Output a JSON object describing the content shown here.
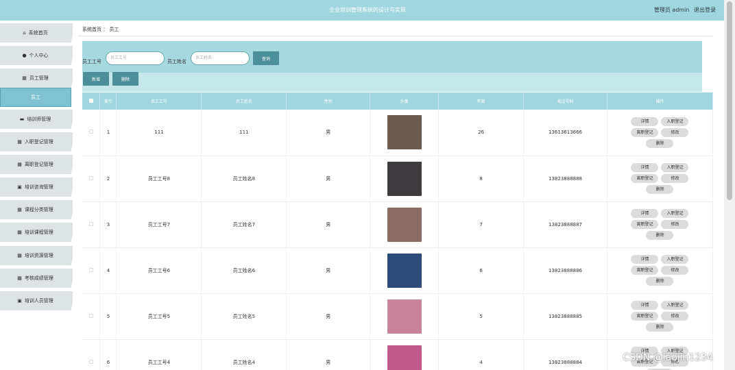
{
  "header": {
    "title": "企业培训管理系统的设计与实现",
    "user_label": "管理员 admin",
    "logout": "退出登录"
  },
  "sidebar": {
    "items": [
      {
        "icon": "home-icon",
        "glyph": "⌂",
        "label": "系统首页"
      },
      {
        "icon": "person-icon",
        "glyph": "●",
        "label": "个人中心"
      },
      {
        "icon": "grid-icon",
        "glyph": "▦",
        "label": "员工管理"
      },
      {
        "icon": "",
        "glyph": "",
        "label": "员工"
      },
      {
        "icon": "briefcase-icon",
        "glyph": "▬",
        "label": "培训师管理"
      },
      {
        "icon": "grid-icon",
        "glyph": "▦",
        "label": "入职登记管理"
      },
      {
        "icon": "grid-icon",
        "glyph": "▦",
        "label": "离职登记管理"
      },
      {
        "icon": "clipboard-icon",
        "glyph": "▣",
        "label": "培训咨询管理"
      },
      {
        "icon": "grid-icon",
        "glyph": "▦",
        "label": "课程分类管理"
      },
      {
        "icon": "grid-icon",
        "glyph": "▦",
        "label": "培训课程管理"
      },
      {
        "icon": "grid-icon",
        "glyph": "▦",
        "label": "培训资源管理"
      },
      {
        "icon": "grid-icon",
        "glyph": "▦",
        "label": "考核成绩管理"
      },
      {
        "icon": "clipboard-icon",
        "glyph": "▣",
        "label": "培训人员管理"
      }
    ]
  },
  "breadcrumb": {
    "home": "系统首页",
    "sep": "：",
    "current": "员工"
  },
  "search": {
    "id_label": "员工工号",
    "id_placeholder": "员工工号",
    "name_label": "员工姓名",
    "name_placeholder": "员工姓名",
    "query_button": "查询"
  },
  "actions": {
    "add": "新增",
    "delete": "删除"
  },
  "table": {
    "headers": [
      "索引",
      "员工工号",
      "员工姓名",
      "性别",
      "头像",
      "年龄",
      "电话号码",
      "操作"
    ],
    "ops": [
      "详情",
      "入职登记",
      "离职登记",
      "修改",
      "删除"
    ],
    "rows": [
      {
        "index": "1",
        "id": "111",
        "name": "111",
        "gender": "男",
        "age": "26",
        "phone": "13613613666",
        "photo_color": "#6b5a4e"
      },
      {
        "index": "2",
        "id": "员工工号8",
        "name": "员工姓名8",
        "gender": "男",
        "age": "8",
        "phone": "13823888888",
        "photo_color": "#3e3a3d"
      },
      {
        "index": "3",
        "id": "员工工号7",
        "name": "员工姓名7",
        "gender": "男",
        "age": "7",
        "phone": "13823888887",
        "photo_color": "#8a6c63"
      },
      {
        "index": "4",
        "id": "员工工号6",
        "name": "员工姓名6",
        "gender": "男",
        "age": "6",
        "phone": "13823888886",
        "photo_color": "#2e4a78"
      },
      {
        "index": "5",
        "id": "员工工号5",
        "name": "员工姓名5",
        "gender": "男",
        "age": "5",
        "phone": "13823888885",
        "photo_color": "#c7849a"
      },
      {
        "index": "6",
        "id": "员工工号4",
        "name": "员工姓名4",
        "gender": "男",
        "age": "4",
        "phone": "13823888884",
        "photo_color": "#c35a8e"
      }
    ]
  },
  "watermark": "CSDN @laojin1234"
}
